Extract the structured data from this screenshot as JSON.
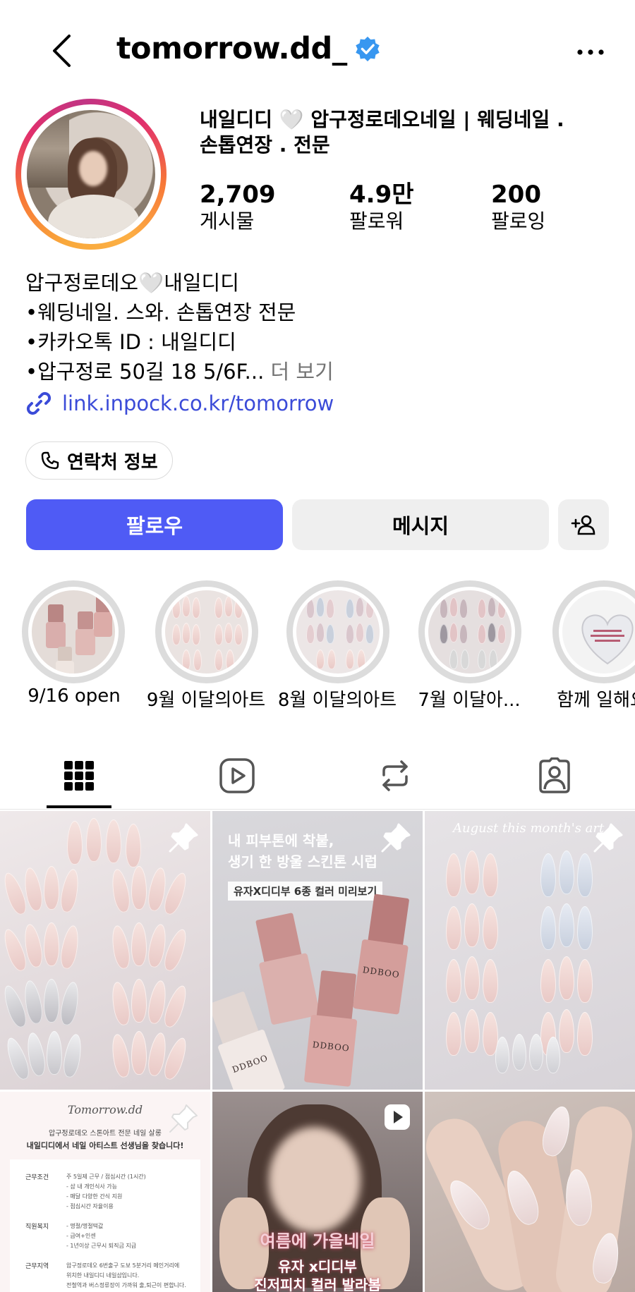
{
  "header": {
    "username": "tomorrow.dd_",
    "verified": true
  },
  "profile": {
    "name_line1": "내일디디 🤍 압구정로데오네일 | 웨딩네일 .",
    "name_line2": "손톱연장 . 전문",
    "stats": [
      {
        "value": "2,709",
        "label": "게시물"
      },
      {
        "value": "4.9만",
        "label": "팔로워"
      },
      {
        "value": "200",
        "label": "팔로잉"
      }
    ],
    "bio": [
      "압구정로데오🤍내일디디",
      "•웨딩네일. 스와. 손톱연장 전문",
      "•카카오톡 ID : 내일디디",
      "•압구정로 50길 18 5/6F..."
    ],
    "bio_more": "더 보기",
    "link": "link.inpock.co.kr/tomorrow",
    "contact_label": "연락처 정보"
  },
  "actions": {
    "follow": "팔로우",
    "message": "메시지"
  },
  "highlights": [
    {
      "label": "9/16 open"
    },
    {
      "label": "9월 이달의아트"
    },
    {
      "label": "8월 이달의아트"
    },
    {
      "label": "7월 이달아..."
    },
    {
      "label": "함께 일해요"
    }
  ],
  "posts": {
    "post2_text_line1": "내 피부톤에 착붙,",
    "post2_text_line2": "생기 한 방울 스킨톤 시럽",
    "post2_tag": "유자X디디부 6종 컬러 미리보기",
    "bottle_brand": "DDBOO",
    "post3_script": "August this month's art",
    "post4_brand": "Tomorrow.dd",
    "post4_line1": "압구정로데오 스톤아트 전문 네일 살롱",
    "post4_line2": "내일디디에서 네일 아티스트 선생님을 찾습니다!",
    "post4_rows": [
      {
        "k": "근무조건",
        "v": [
          "주 5일제 근무 / 점심시간 (1시간)",
          "- 샵 내 개인식사 가능",
          "- 매달 다양한 간식 지원",
          "- 점심시간 자율이용"
        ]
      },
      {
        "k": "직원복지",
        "v": [
          "- 명절/명절떡값",
          "- 급여+인센",
          "- 1년이상 근무시 퇴직금 지급"
        ]
      },
      {
        "k": "근무지역",
        "v": [
          "압구정로데오 6번출구 도보 5분거리 메인거리에",
          "위치한 내일디디 네일샵입니다.",
          "전철역과 버스정류장이 가까워 출,퇴근이 편합니다."
        ]
      }
    ],
    "post5_caption1": "여름에 가을네일",
    "post5_caption2": "유자 x디디부",
    "post5_caption3": "진저피치 컬러 발라봄"
  }
}
